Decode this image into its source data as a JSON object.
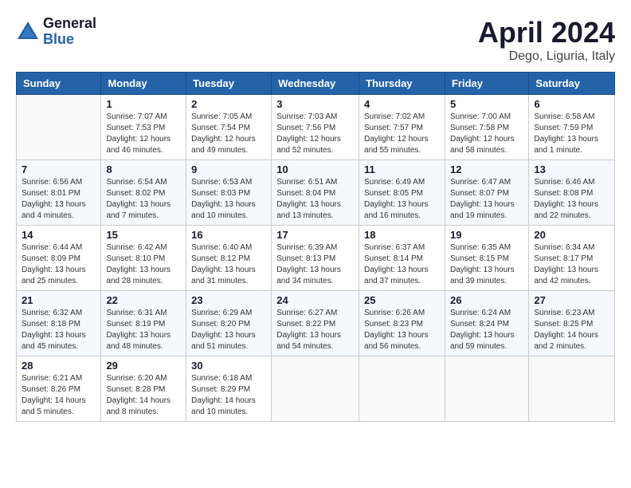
{
  "header": {
    "logo_general": "General",
    "logo_blue": "Blue",
    "month_title": "April 2024",
    "location": "Dego, Liguria, Italy"
  },
  "weekdays": [
    "Sunday",
    "Monday",
    "Tuesday",
    "Wednesday",
    "Thursday",
    "Friday",
    "Saturday"
  ],
  "weeks": [
    [
      {
        "day": "",
        "sunrise": "",
        "sunset": "",
        "daylight": ""
      },
      {
        "day": "1",
        "sunrise": "Sunrise: 7:07 AM",
        "sunset": "Sunset: 7:53 PM",
        "daylight": "Daylight: 12 hours and 46 minutes."
      },
      {
        "day": "2",
        "sunrise": "Sunrise: 7:05 AM",
        "sunset": "Sunset: 7:54 PM",
        "daylight": "Daylight: 12 hours and 49 minutes."
      },
      {
        "day": "3",
        "sunrise": "Sunrise: 7:03 AM",
        "sunset": "Sunset: 7:56 PM",
        "daylight": "Daylight: 12 hours and 52 minutes."
      },
      {
        "day": "4",
        "sunrise": "Sunrise: 7:02 AM",
        "sunset": "Sunset: 7:57 PM",
        "daylight": "Daylight: 12 hours and 55 minutes."
      },
      {
        "day": "5",
        "sunrise": "Sunrise: 7:00 AM",
        "sunset": "Sunset: 7:58 PM",
        "daylight": "Daylight: 12 hours and 58 minutes."
      },
      {
        "day": "6",
        "sunrise": "Sunrise: 6:58 AM",
        "sunset": "Sunset: 7:59 PM",
        "daylight": "Daylight: 13 hours and 1 minute."
      }
    ],
    [
      {
        "day": "7",
        "sunrise": "Sunrise: 6:56 AM",
        "sunset": "Sunset: 8:01 PM",
        "daylight": "Daylight: 13 hours and 4 minutes."
      },
      {
        "day": "8",
        "sunrise": "Sunrise: 6:54 AM",
        "sunset": "Sunset: 8:02 PM",
        "daylight": "Daylight: 13 hours and 7 minutes."
      },
      {
        "day": "9",
        "sunrise": "Sunrise: 6:53 AM",
        "sunset": "Sunset: 8:03 PM",
        "daylight": "Daylight: 13 hours and 10 minutes."
      },
      {
        "day": "10",
        "sunrise": "Sunrise: 6:51 AM",
        "sunset": "Sunset: 8:04 PM",
        "daylight": "Daylight: 13 hours and 13 minutes."
      },
      {
        "day": "11",
        "sunrise": "Sunrise: 6:49 AM",
        "sunset": "Sunset: 8:05 PM",
        "daylight": "Daylight: 13 hours and 16 minutes."
      },
      {
        "day": "12",
        "sunrise": "Sunrise: 6:47 AM",
        "sunset": "Sunset: 8:07 PM",
        "daylight": "Daylight: 13 hours and 19 minutes."
      },
      {
        "day": "13",
        "sunrise": "Sunrise: 6:46 AM",
        "sunset": "Sunset: 8:08 PM",
        "daylight": "Daylight: 13 hours and 22 minutes."
      }
    ],
    [
      {
        "day": "14",
        "sunrise": "Sunrise: 6:44 AM",
        "sunset": "Sunset: 8:09 PM",
        "daylight": "Daylight: 13 hours and 25 minutes."
      },
      {
        "day": "15",
        "sunrise": "Sunrise: 6:42 AM",
        "sunset": "Sunset: 8:10 PM",
        "daylight": "Daylight: 13 hours and 28 minutes."
      },
      {
        "day": "16",
        "sunrise": "Sunrise: 6:40 AM",
        "sunset": "Sunset: 8:12 PM",
        "daylight": "Daylight: 13 hours and 31 minutes."
      },
      {
        "day": "17",
        "sunrise": "Sunrise: 6:39 AM",
        "sunset": "Sunset: 8:13 PM",
        "daylight": "Daylight: 13 hours and 34 minutes."
      },
      {
        "day": "18",
        "sunrise": "Sunrise: 6:37 AM",
        "sunset": "Sunset: 8:14 PM",
        "daylight": "Daylight: 13 hours and 37 minutes."
      },
      {
        "day": "19",
        "sunrise": "Sunrise: 6:35 AM",
        "sunset": "Sunset: 8:15 PM",
        "daylight": "Daylight: 13 hours and 39 minutes."
      },
      {
        "day": "20",
        "sunrise": "Sunrise: 6:34 AM",
        "sunset": "Sunset: 8:17 PM",
        "daylight": "Daylight: 13 hours and 42 minutes."
      }
    ],
    [
      {
        "day": "21",
        "sunrise": "Sunrise: 6:32 AM",
        "sunset": "Sunset: 8:18 PM",
        "daylight": "Daylight: 13 hours and 45 minutes."
      },
      {
        "day": "22",
        "sunrise": "Sunrise: 6:31 AM",
        "sunset": "Sunset: 8:19 PM",
        "daylight": "Daylight: 13 hours and 48 minutes."
      },
      {
        "day": "23",
        "sunrise": "Sunrise: 6:29 AM",
        "sunset": "Sunset: 8:20 PM",
        "daylight": "Daylight: 13 hours and 51 minutes."
      },
      {
        "day": "24",
        "sunrise": "Sunrise: 6:27 AM",
        "sunset": "Sunset: 8:22 PM",
        "daylight": "Daylight: 13 hours and 54 minutes."
      },
      {
        "day": "25",
        "sunrise": "Sunrise: 6:26 AM",
        "sunset": "Sunset: 8:23 PM",
        "daylight": "Daylight: 13 hours and 56 minutes."
      },
      {
        "day": "26",
        "sunrise": "Sunrise: 6:24 AM",
        "sunset": "Sunset: 8:24 PM",
        "daylight": "Daylight: 13 hours and 59 minutes."
      },
      {
        "day": "27",
        "sunrise": "Sunrise: 6:23 AM",
        "sunset": "Sunset: 8:25 PM",
        "daylight": "Daylight: 14 hours and 2 minutes."
      }
    ],
    [
      {
        "day": "28",
        "sunrise": "Sunrise: 6:21 AM",
        "sunset": "Sunset: 8:26 PM",
        "daylight": "Daylight: 14 hours and 5 minutes."
      },
      {
        "day": "29",
        "sunrise": "Sunrise: 6:20 AM",
        "sunset": "Sunset: 8:28 PM",
        "daylight": "Daylight: 14 hours and 8 minutes."
      },
      {
        "day": "30",
        "sunrise": "Sunrise: 6:18 AM",
        "sunset": "Sunset: 8:29 PM",
        "daylight": "Daylight: 14 hours and 10 minutes."
      },
      {
        "day": "",
        "sunrise": "",
        "sunset": "",
        "daylight": ""
      },
      {
        "day": "",
        "sunrise": "",
        "sunset": "",
        "daylight": ""
      },
      {
        "day": "",
        "sunrise": "",
        "sunset": "",
        "daylight": ""
      },
      {
        "day": "",
        "sunrise": "",
        "sunset": "",
        "daylight": ""
      }
    ]
  ]
}
